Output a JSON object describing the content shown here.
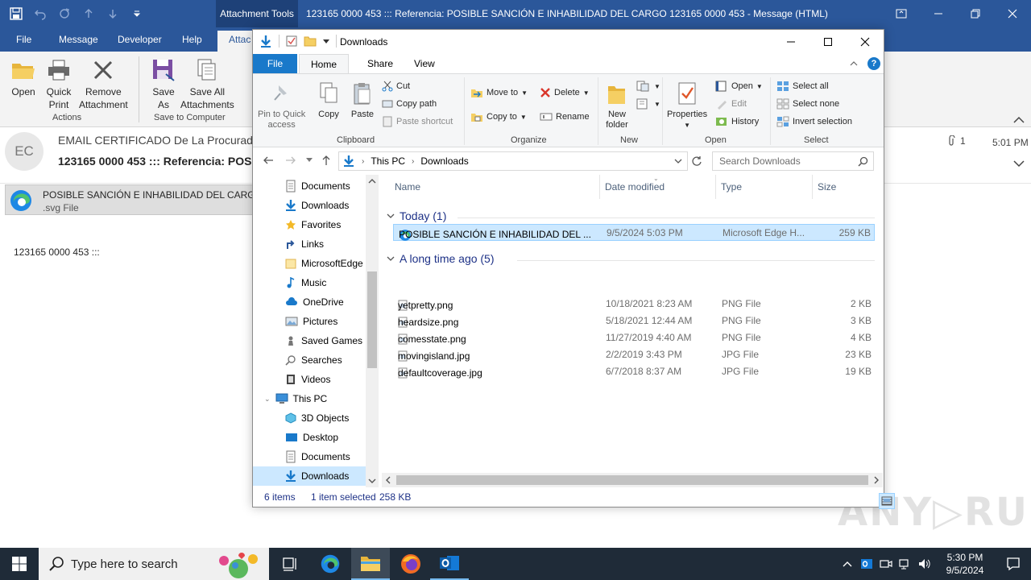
{
  "outlook": {
    "context_tab": "Attachment Tools",
    "window_title": "123165 0000 453 ::: Referencia: POSIBLE SANCIÓN E INHABILIDAD DEL CARGO 123165 0000 453  -  Message (HTML)",
    "tabs": [
      "File",
      "Message",
      "Developer",
      "Help",
      "Attac"
    ],
    "ribbon": {
      "open": "Open",
      "quick_print_1": "Quick",
      "quick_print_2": "Print",
      "remove_1": "Remove",
      "remove_2": "Attachment",
      "actions_group": "Actions",
      "save_as_1": "Save",
      "save_as_2": "As",
      "save_all_1": "Save All",
      "save_all_2": "Attachments",
      "save_group": "Save to Computer"
    },
    "avatar_initials": "EC",
    "from": "EMAIL CERTIFICADO De La Procuradu",
    "subject": "123165 0000 453 ::: Referencia: POSI",
    "attachment_count": "1",
    "time": "5:01 PM",
    "attachment_name": "POSIBLE SANCIÓN  E INHABILIDAD DEL CARGO.s",
    "attachment_type": ".svg File",
    "body_text": "123165  0000  453  :::"
  },
  "explorer": {
    "title": "Downloads",
    "tabs": {
      "file": "File",
      "home": "Home",
      "share": "Share",
      "view": "View"
    },
    "ribbon": {
      "pin_1": "Pin to Quick",
      "pin_2": "access",
      "copy": "Copy",
      "paste": "Paste",
      "cut": "Cut",
      "copy_path": "Copy path",
      "paste_shortcut": "Paste shortcut",
      "clipboard": "Clipboard",
      "move_to": "Move to",
      "copy_to": "Copy to",
      "delete": "Delete",
      "rename": "Rename",
      "organize": "Organize",
      "new_folder_1": "New",
      "new_folder_2": "folder",
      "new": "New",
      "properties": "Properties",
      "open": "Open",
      "edit": "Edit",
      "history": "History",
      "open_group": "Open",
      "select_all": "Select all",
      "select_none": "Select none",
      "invert": "Invert selection",
      "select_group": "Select"
    },
    "address": {
      "crumbs": [
        "This PC",
        "Downloads"
      ]
    },
    "search_placeholder": "Search Downloads",
    "nav": [
      "Documents",
      "Downloads",
      "Favorites",
      "Links",
      "MicrosoftEdge",
      "Music",
      "OneDrive",
      "Pictures",
      "Saved Games",
      "Searches",
      "Videos",
      "This PC",
      "3D Objects",
      "Desktop",
      "Documents",
      "Downloads"
    ],
    "columns": {
      "name": "Name",
      "date": "Date modified",
      "type": "Type",
      "size": "Size"
    },
    "groups": {
      "today": "Today (1)",
      "older": "A long time ago (5)"
    },
    "files": [
      {
        "name": "POSIBLE SANCIÓN  E INHABILIDAD DEL ...",
        "date": "9/5/2024 5:03 PM",
        "type": "Microsoft Edge H...",
        "size": "259 KB"
      },
      {
        "name": "yetpretty.png",
        "date": "10/18/2021 8:23 AM",
        "type": "PNG File",
        "size": "2 KB"
      },
      {
        "name": "heardsize.png",
        "date": "5/18/2021 12:44 AM",
        "type": "PNG File",
        "size": "3 KB"
      },
      {
        "name": "comesstate.png",
        "date": "11/27/2019 4:40 AM",
        "type": "PNG File",
        "size": "4 KB"
      },
      {
        "name": "movingisland.jpg",
        "date": "2/2/2019 3:43 PM",
        "type": "JPG File",
        "size": "23 KB"
      },
      {
        "name": "defaultcoverage.jpg",
        "date": "6/7/2018 8:37 AM",
        "type": "JPG File",
        "size": "19 KB"
      }
    ],
    "status": {
      "items": "6 items",
      "selected": "1 item selected",
      "size": "258 KB"
    }
  },
  "watermark": "ANY RUN",
  "taskbar": {
    "search_placeholder": "Type here to search",
    "time": "5:30 PM",
    "date": "9/5/2024"
  },
  "colors": {
    "outlook_blue": "#2b579a",
    "explorer_file_tab": "#1979ca",
    "selection": "#cce8ff",
    "taskbar": "#1f2b38"
  }
}
